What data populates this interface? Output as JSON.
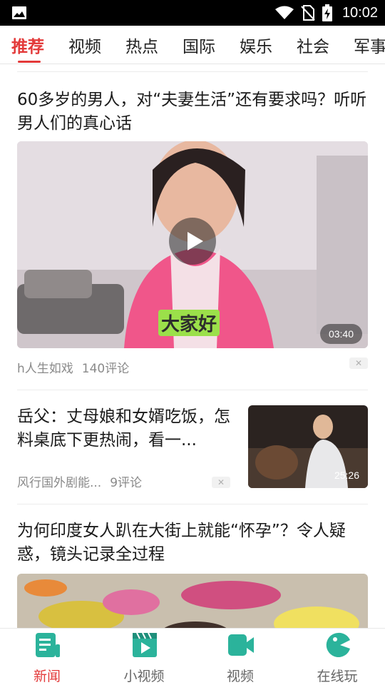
{
  "status_bar": {
    "time": "10:02"
  },
  "tabs": [
    {
      "label": "推荐",
      "active": true
    },
    {
      "label": "视频"
    },
    {
      "label": "热点"
    },
    {
      "label": "国际"
    },
    {
      "label": "娱乐"
    },
    {
      "label": "社会"
    },
    {
      "label": "军事"
    }
  ],
  "feed": [
    {
      "title": "60多岁的男人，对“夫妻生活”还有要求吗？听听男人们的真心话",
      "source": "h人生如戏",
      "comments": "140评论",
      "duration": "03:40",
      "caption": "大家好"
    },
    {
      "title": "岳父：丈母娘和女婿吃饭，怎料桌底下更热闹，看一...",
      "source": "风行国外剧能...",
      "comments": "9评论",
      "duration": "25:26"
    },
    {
      "title": "为何印度女人趴在大街上就能“怀孕”？令人疑惑，镜头记录全过程"
    }
  ],
  "bottom_nav": [
    {
      "label": "新闻",
      "icon": "news-icon",
      "active": true
    },
    {
      "label": "小视频",
      "icon": "short-video-icon"
    },
    {
      "label": "视频",
      "icon": "video-camera-icon"
    },
    {
      "label": "在线玩",
      "icon": "game-icon"
    }
  ],
  "colors": {
    "accent": "#e33a3a",
    "nav_icon": "#2bb39b"
  }
}
